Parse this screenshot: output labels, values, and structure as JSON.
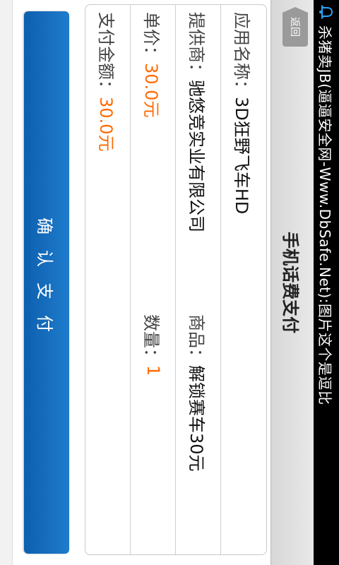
{
  "statusbar": {
    "notification_icon": "bell-icon",
    "text": "杀猪卖JB(逼逼安全网-Www.DbSafe.Net):图片这个是逗比"
  },
  "header": {
    "back_label": "返回",
    "title": "手机话费支付"
  },
  "details": {
    "app_name_label": "应用名称：",
    "app_name_value": "3D狂野飞车HD",
    "provider_label": "提供商：",
    "provider_value": "驰悠竞实业有限公司",
    "product_label": "商品：",
    "product_value": "解锁赛车30元",
    "unit_price_label": "单价：",
    "unit_price_value": "30.0元",
    "quantity_label": "数量：",
    "quantity_value": "1",
    "total_label": "支付金额：",
    "total_value": "30.0元"
  },
  "actions": {
    "confirm_label": "确认支付"
  },
  "colors": {
    "accent_blue": "#0d5fae",
    "price_orange": "#ff6a00"
  }
}
